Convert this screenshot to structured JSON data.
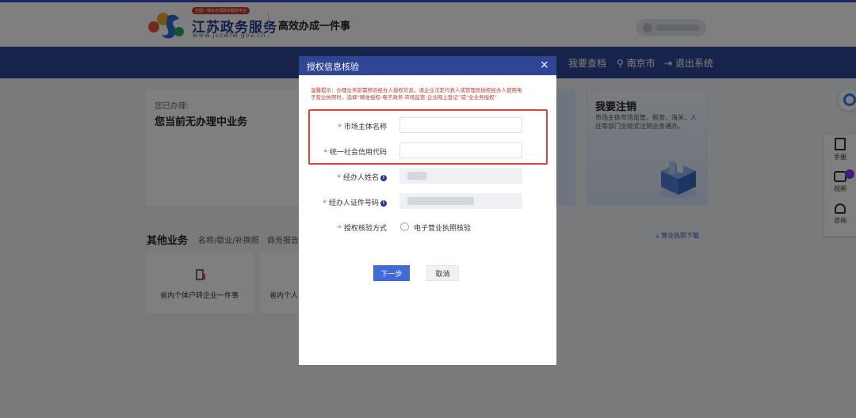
{
  "header": {
    "logo_ribbon": "全国一体化在线政务服务平台",
    "logo_title": "江苏政务服务",
    "logo_sub": "www.jszwfw.gov.cn",
    "slogan": "高效办成一件事"
  },
  "nav": {
    "items": [
      {
        "label": "我要查档"
      },
      {
        "label": "南京市"
      },
      {
        "label": "退出系统"
      }
    ]
  },
  "dashboard": {
    "done_label": "您已办理:",
    "done_value": "您当前无办理中业务",
    "cancel_title": "我要注销",
    "cancel_desc": "市场主体市场监管、税务、海关、人社等部门全链式注销业务通办。"
  },
  "side": {
    "manual": "手册",
    "video": "视频",
    "consult": "咨询"
  },
  "other": {
    "title": "其他业务",
    "tabs": [
      "名称/歇业/补换照",
      "商务报告"
    ],
    "download": "营业执照下载",
    "cards": [
      "省内个体户转企业一件事",
      "省内个人"
    ]
  },
  "modal": {
    "title": "授权信息核验",
    "close": "×",
    "tip": "温馨提示：办理业务前需核验经办人授权信息，请企业法定代表人或管理员授权经办人使用电子营业执照时，选择“精准授权-电子政务-市场监管-企业网上登记”或“全业务授权”",
    "fields": [
      {
        "label": "市场主体名称",
        "value": "",
        "placeholder": ""
      },
      {
        "label": "统一社会信用代码",
        "value": "",
        "placeholder": ""
      },
      {
        "label": "经办人姓名"
      },
      {
        "label": "经办人证件号码"
      }
    ],
    "verify_label": "授权核验方式",
    "verify_option": "电子营业执照核验",
    "next": "下一步",
    "cancel": "取消"
  },
  "colors": {
    "nav_bg": "#2f4694",
    "highlight": "#e8413b",
    "primary_button": "#3f6ad8"
  }
}
